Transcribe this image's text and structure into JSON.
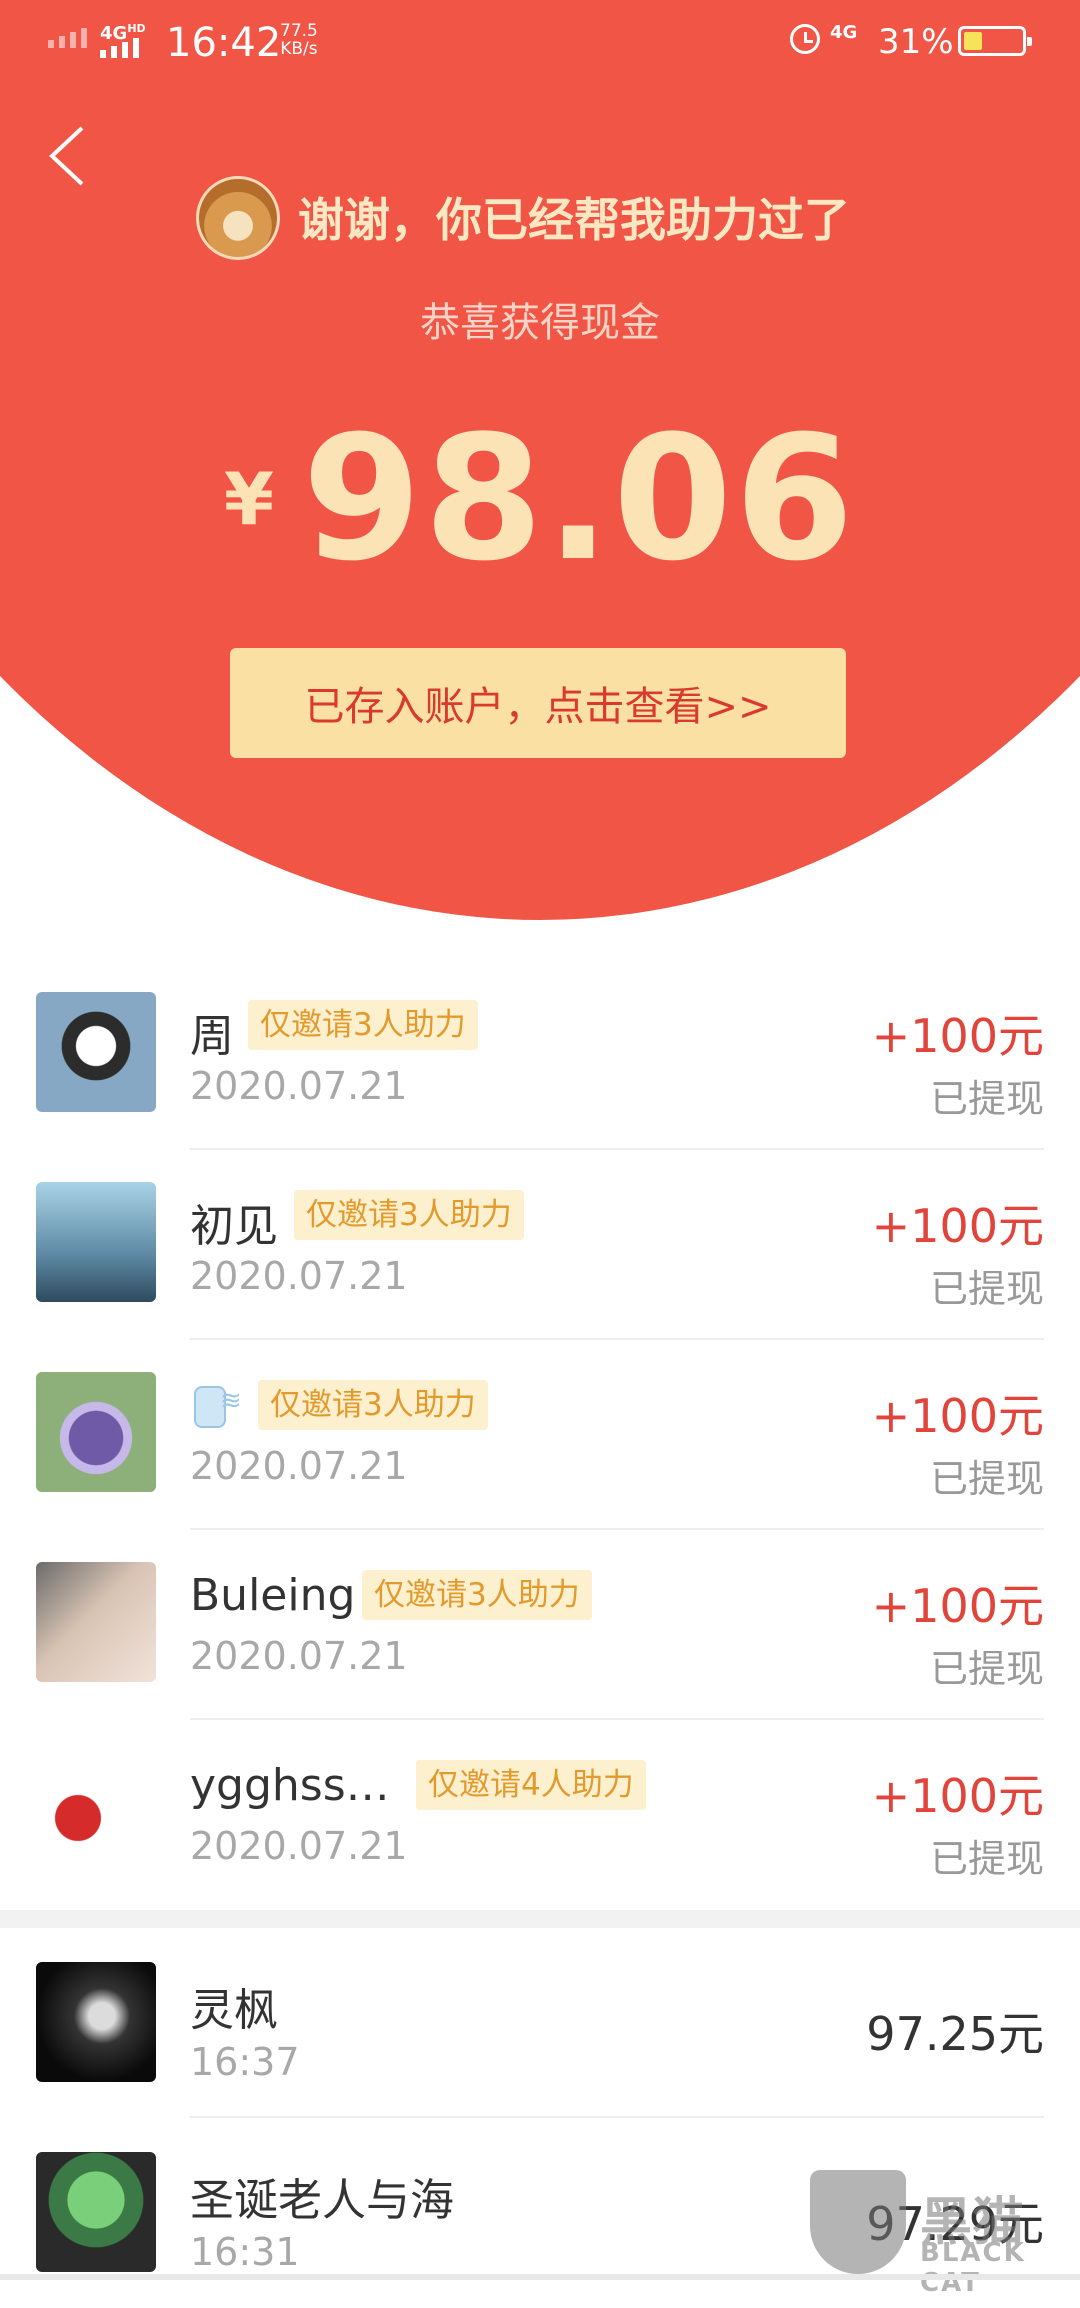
{
  "status_bar": {
    "network_1": "4G",
    "network_hd": "HD",
    "time": "16:42",
    "speed_value": "77.5",
    "speed_unit": "KB/s",
    "network_2": "4G",
    "battery_percent": "31%",
    "battery_level": 0.31
  },
  "header": {
    "thanks_message": "谢谢，你已经帮我助力过了",
    "congrats_label": "恭喜获得现金",
    "currency_symbol": "¥",
    "amount": "98.06",
    "deposit_button": "已存入账户，点击查看>>"
  },
  "invite_list": [
    {
      "name": "周",
      "badge": "仅邀请3人助力",
      "date": "2020.07.21",
      "reward": "+100元",
      "status": "已提现"
    },
    {
      "name": "初见",
      "badge": "仅邀请3人助力",
      "date": "2020.07.21",
      "reward": "+100元",
      "status": "已提现"
    },
    {
      "name": "",
      "badge": "仅邀请3人助力",
      "date": "2020.07.21",
      "reward": "+100元",
      "status": "已提现"
    },
    {
      "name": "Buleing",
      "badge": "仅邀请3人助力",
      "date": "2020.07.21",
      "reward": "+100元",
      "status": "已提现"
    },
    {
      "name": "ygghss…",
      "badge": "仅邀请4人助力",
      "date": "2020.07.21",
      "reward": "+100元",
      "status": "已提现"
    }
  ],
  "records": [
    {
      "name": "灵枫",
      "time": "16:37",
      "value": "97.25元"
    },
    {
      "name": "圣诞老人与海",
      "time": "16:31",
      "value": "97.29元"
    }
  ],
  "watermark": {
    "text": "黑猫",
    "sub": "BLACK CAT"
  },
  "colors": {
    "hero_red": "#f15545",
    "gold_text": "#fbe3b6",
    "button_bg": "#fbe0a4",
    "reward_red": "#e0443a",
    "badge_orange": "#e39a2d"
  }
}
